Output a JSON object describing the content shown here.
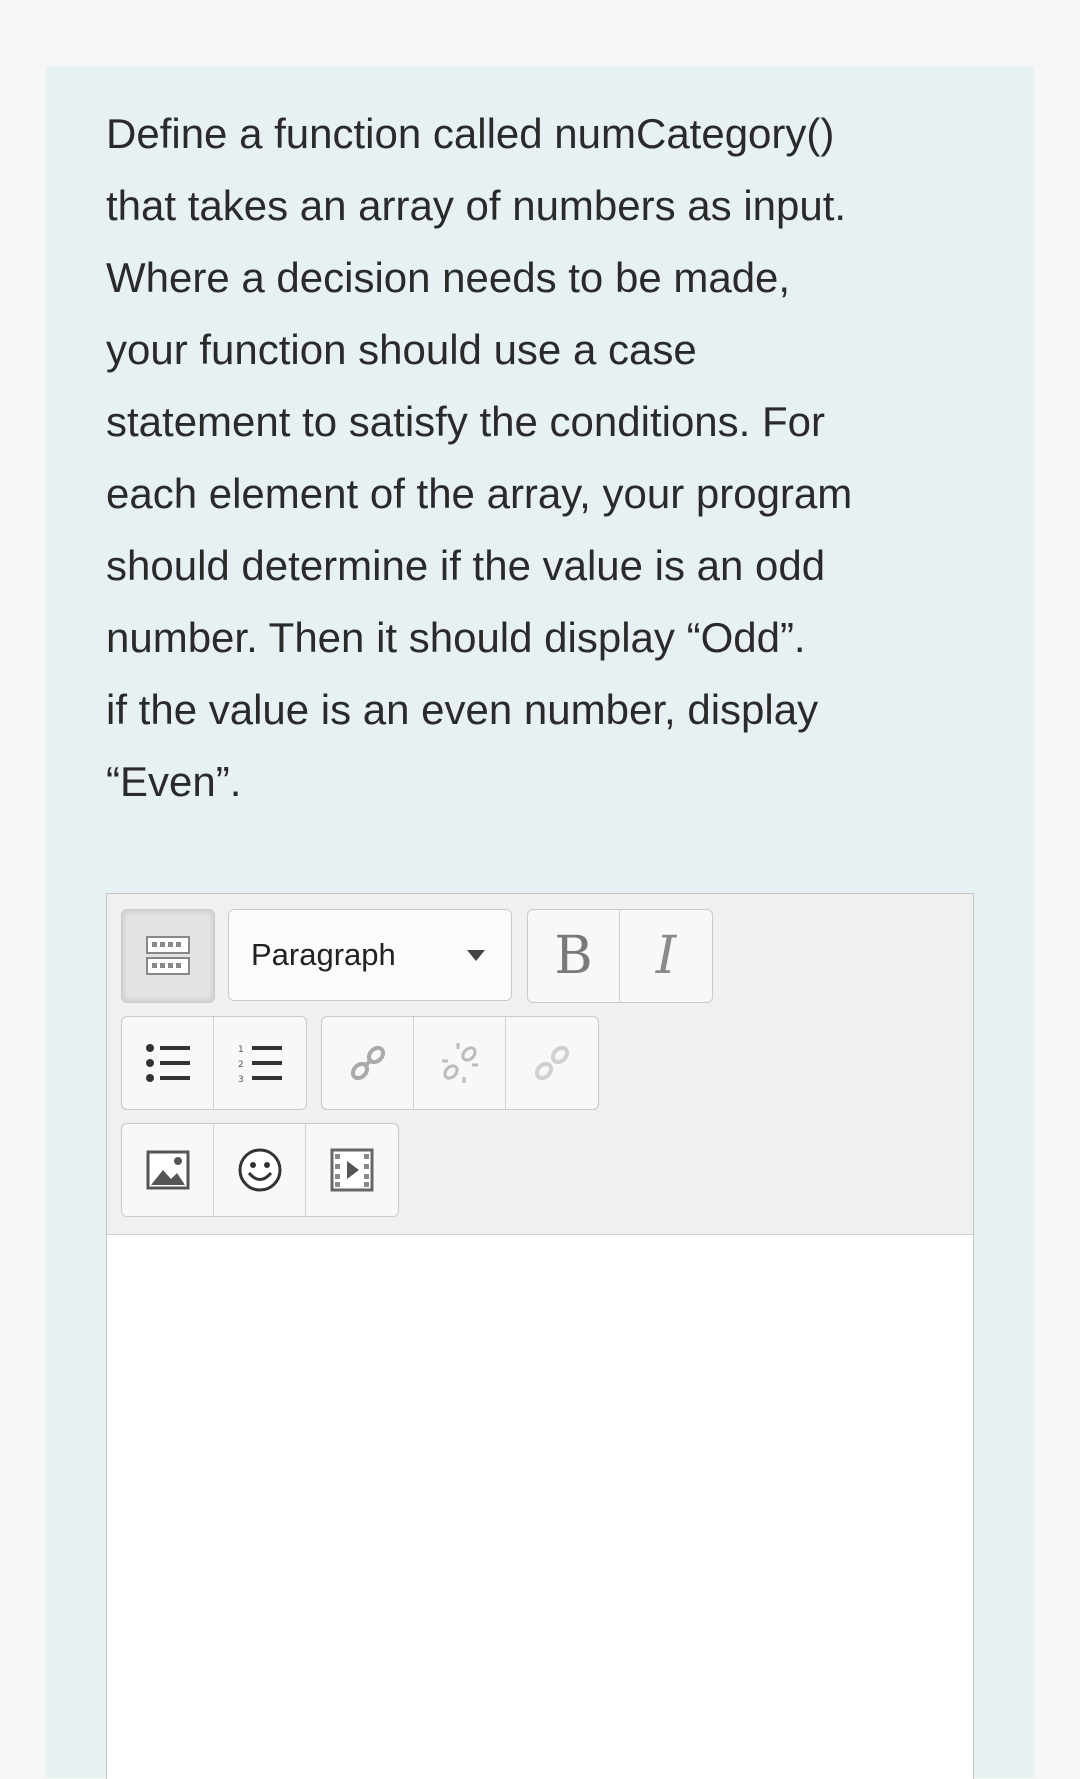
{
  "question": {
    "lines": [
      "Define a function called numCategory()",
      "that takes an array of numbers as input.",
      "Where a decision needs to be made,",
      "your function should use a case",
      "statement to satisfy the conditions. For",
      "each element of the array, your program",
      "should determine if the value is an odd",
      "number. Then it should display “Odd”.",
      "if the value is an even number, display",
      "“Even”."
    ]
  },
  "editor": {
    "toolbar": {
      "toggle_icon": "toolbar-toggle-icon",
      "block_format": {
        "selected": "Paragraph",
        "icon": "chevron-down-icon"
      },
      "bold_label": "B",
      "italic_label": "I",
      "list_icons": [
        "unordered-list-icon",
        "ordered-list-icon"
      ],
      "link_icons": [
        "link-icon",
        "unlink-icon",
        "manage-files-icon"
      ],
      "media_icons": [
        "image-icon",
        "emoticon-icon",
        "media-icon"
      ]
    },
    "content": ""
  }
}
